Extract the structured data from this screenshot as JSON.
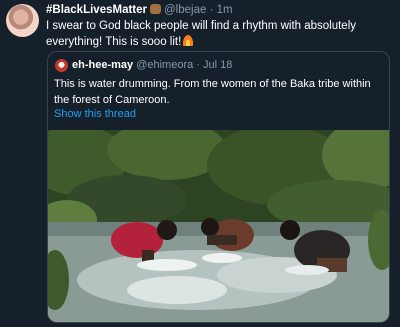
{
  "tweet": {
    "name": "#BlackLivesMatter",
    "handle": "@lbejae",
    "separator": "·",
    "time": "1m",
    "text": "I swear to God black people will find a rhythm with absolutely everything! This is sooo lit!"
  },
  "quoted_tweet": {
    "name": "eh-hee-may",
    "handle": "@ehimeora",
    "separator": "·",
    "time": "Jul 18",
    "text": "This is water drumming. From the women of the Baka tribe within the forest of Cameroon.",
    "show_thread": "Show this thread"
  },
  "icons": {
    "fist": "raised-fist-emoji-icon",
    "fire": "fire-emoji-icon"
  },
  "colors": {
    "background": "#15202b",
    "secondary_text": "#8899a6",
    "link": "#1da1f2",
    "border": "#38444d"
  }
}
